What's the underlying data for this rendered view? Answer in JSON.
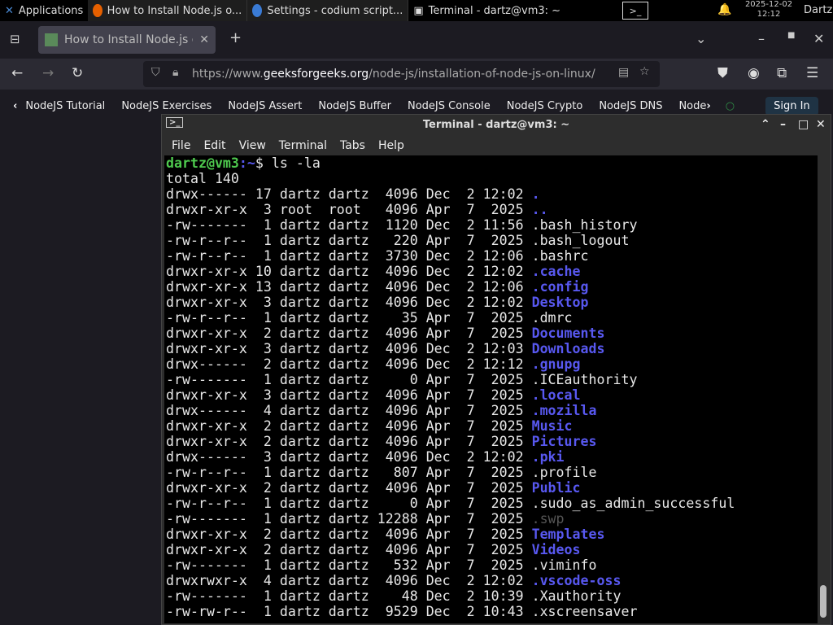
{
  "taskbar": {
    "apps": "Applications",
    "windows": [
      "How to Install Node.js o...",
      "Settings - codium script...",
      "Terminal - dartz@vm3: ~"
    ],
    "date": "2025-12-02",
    "time": "12:12",
    "user": "Dartz"
  },
  "browser": {
    "tab": "How to Install Node.js on",
    "url_pre": "https://www.",
    "url_domain": "geeksforgeeks.org",
    "url_path": "/node-js/installation-of-node-js-on-linux/",
    "bookmarks": [
      "NodeJS Tutorial",
      "NodeJS Exercises",
      "NodeJS Assert",
      "NodeJS Buffer",
      "NodeJS Console",
      "NodeJS Crypto",
      "NodeJS DNS",
      "Node"
    ],
    "signin": "Sign In"
  },
  "terminal": {
    "title": "Terminal - dartz@vm3: ~",
    "menu": [
      "File",
      "Edit",
      "View",
      "Terminal",
      "Tabs",
      "Help"
    ],
    "prompt_user": "dartz@vm3",
    "prompt_path": ":~",
    "prompt_sym": "$ ",
    "command": "ls -la",
    "total": "total 140",
    "rows": [
      [
        "drwx------ 17 dartz dartz  4096 Dec  2 12:02 ",
        ".",
        "dir"
      ],
      [
        "drwxr-xr-x  3 root  root   4096 Apr  7  2025 ",
        "..",
        "dir"
      ],
      [
        "-rw-------  1 dartz dartz  1120 Dec  2 11:56 ",
        ".bash_history",
        ""
      ],
      [
        "-rw-r--r--  1 dartz dartz   220 Apr  7  2025 ",
        ".bash_logout",
        ""
      ],
      [
        "-rw-r--r--  1 dartz dartz  3730 Dec  2 12:06 ",
        ".bashrc",
        ""
      ],
      [
        "drwxr-xr-x 10 dartz dartz  4096 Dec  2 12:02 ",
        ".cache",
        "dir"
      ],
      [
        "drwxr-xr-x 13 dartz dartz  4096 Dec  2 12:06 ",
        ".config",
        "dir"
      ],
      [
        "drwxr-xr-x  3 dartz dartz  4096 Dec  2 12:02 ",
        "Desktop",
        "dir"
      ],
      [
        "-rw-r--r--  1 dartz dartz    35 Apr  7  2025 ",
        ".dmrc",
        ""
      ],
      [
        "drwxr-xr-x  2 dartz dartz  4096 Apr  7  2025 ",
        "Documents",
        "dir"
      ],
      [
        "drwxr-xr-x  3 dartz dartz  4096 Dec  2 12:03 ",
        "Downloads",
        "dir"
      ],
      [
        "drwx------  2 dartz dartz  4096 Dec  2 12:12 ",
        ".gnupg",
        "dir"
      ],
      [
        "-rw-------  1 dartz dartz     0 Apr  7  2025 ",
        ".ICEauthority",
        ""
      ],
      [
        "drwxr-xr-x  3 dartz dartz  4096 Apr  7  2025 ",
        ".local",
        "dir"
      ],
      [
        "drwx------  4 dartz dartz  4096 Apr  7  2025 ",
        ".mozilla",
        "dir"
      ],
      [
        "drwxr-xr-x  2 dartz dartz  4096 Apr  7  2025 ",
        "Music",
        "dir"
      ],
      [
        "drwxr-xr-x  2 dartz dartz  4096 Apr  7  2025 ",
        "Pictures",
        "dir"
      ],
      [
        "drwx------  3 dartz dartz  4096 Dec  2 12:02 ",
        ".pki",
        "dir"
      ],
      [
        "-rw-r--r--  1 dartz dartz   807 Apr  7  2025 ",
        ".profile",
        ""
      ],
      [
        "drwxr-xr-x  2 dartz dartz  4096 Apr  7  2025 ",
        "Public",
        "dir"
      ],
      [
        "-rw-r--r--  1 dartz dartz     0 Apr  7  2025 ",
        ".sudo_as_admin_successful",
        ""
      ],
      [
        "-rw-------  1 dartz dartz 12288 Apr  7  2025 ",
        ".swp",
        "dim"
      ],
      [
        "drwxr-xr-x  2 dartz dartz  4096 Apr  7  2025 ",
        "Templates",
        "dir"
      ],
      [
        "drwxr-xr-x  2 dartz dartz  4096 Apr  7  2025 ",
        "Videos",
        "dir"
      ],
      [
        "-rw-------  1 dartz dartz   532 Apr  7  2025 ",
        ".viminfo",
        ""
      ],
      [
        "drwxrwxr-x  4 dartz dartz  4096 Dec  2 12:02 ",
        ".vscode-oss",
        "dir"
      ],
      [
        "-rw-------  1 dartz dartz    48 Dec  2 10:39 ",
        ".Xauthority",
        ""
      ],
      [
        "-rw-rw-r--  1 dartz dartz  9529 Dec  2 10:43 ",
        ".xscreensaver",
        ""
      ]
    ]
  },
  "colors": {
    "dir": "#5858f0",
    "prompt": "#4ec94e",
    "terminal_bg": "#000000"
  }
}
